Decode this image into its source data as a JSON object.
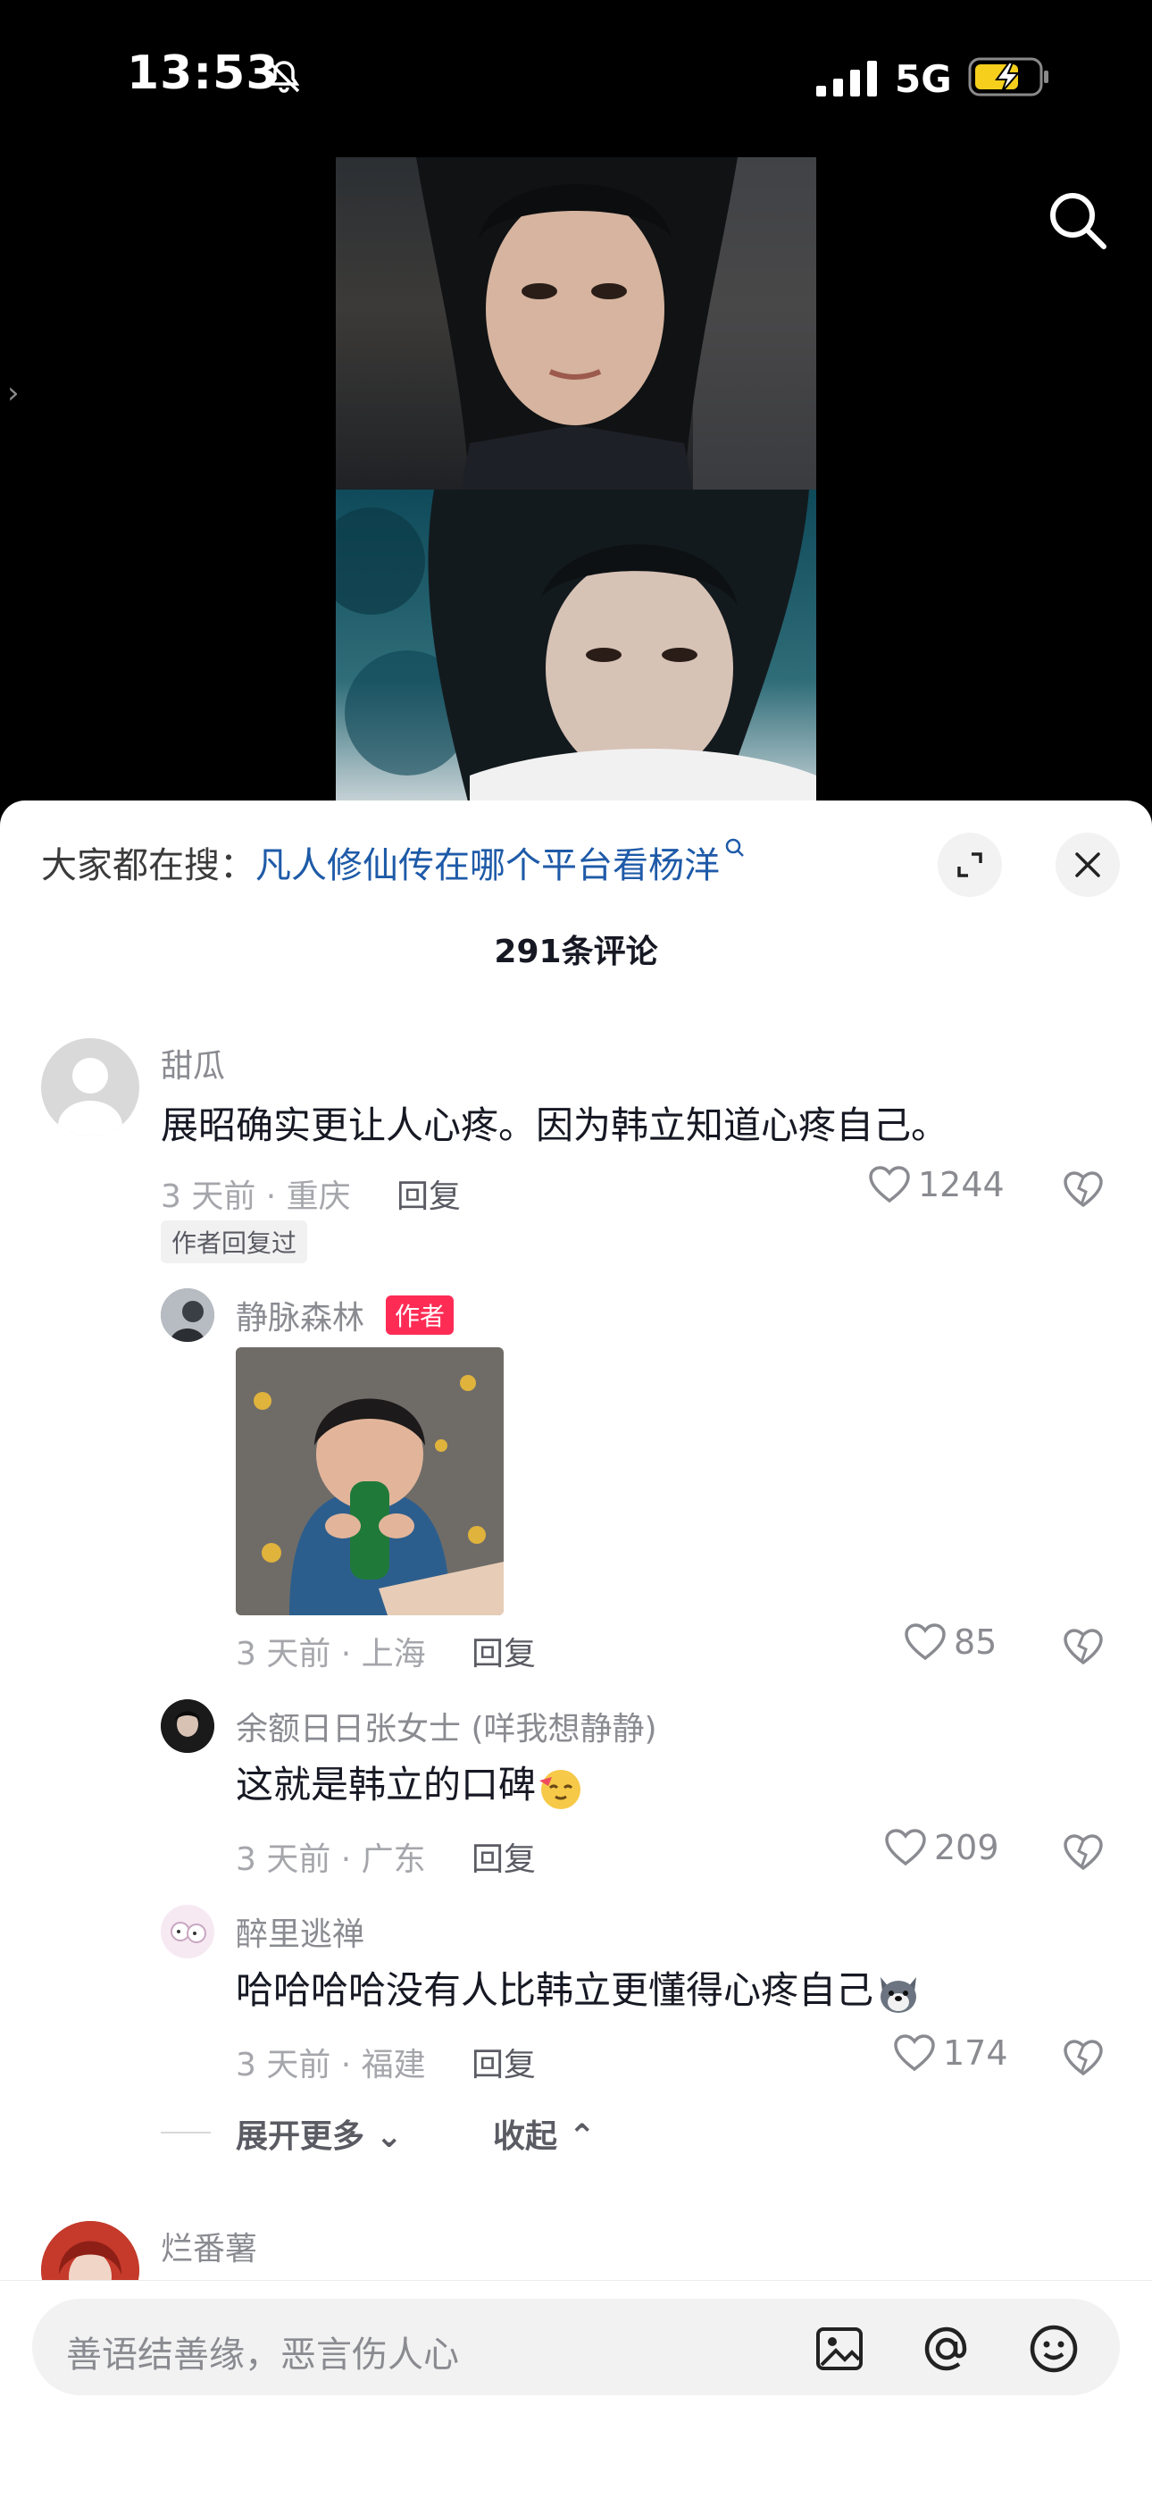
{
  "status_bar": {
    "time": "13:53",
    "network": "5G"
  },
  "comments_panel": {
    "search_hint_prefix": "大家都在搜：",
    "search_hint_query": "凡人修仙传在哪个平台看杨洋",
    "count_label": "291条评论"
  },
  "comments": [
    {
      "username": "甜瓜",
      "text": "展昭确实更让人心疼。因为韩立知道心疼自己。",
      "meta": "3 天前 · 重庆",
      "reply_label": "回复",
      "likes": "1244",
      "tag": "作者回复过",
      "replies": [
        {
          "username": "静脉森林",
          "badge": "作者",
          "meta": "3 天前 · 上海",
          "reply_label": "回复",
          "likes": "85"
        },
        {
          "username": "余额日日张女士 (咩我想静静)",
          "text": "这就是韩立的口碑",
          "meta": "3 天前 · 广东",
          "reply_label": "回复",
          "likes": "209"
        },
        {
          "username": "醉里逃禅",
          "text": "哈哈哈哈没有人比韩立更懂得心疼自己",
          "meta": "3 天前 · 福建",
          "reply_label": "回复",
          "likes": "174"
        }
      ],
      "expand_more_label": "展开更多",
      "collapse_label": "收起"
    },
    {
      "username": "烂番薯"
    }
  ],
  "input": {
    "placeholder": "善语结善缘，恶言伤人心"
  }
}
